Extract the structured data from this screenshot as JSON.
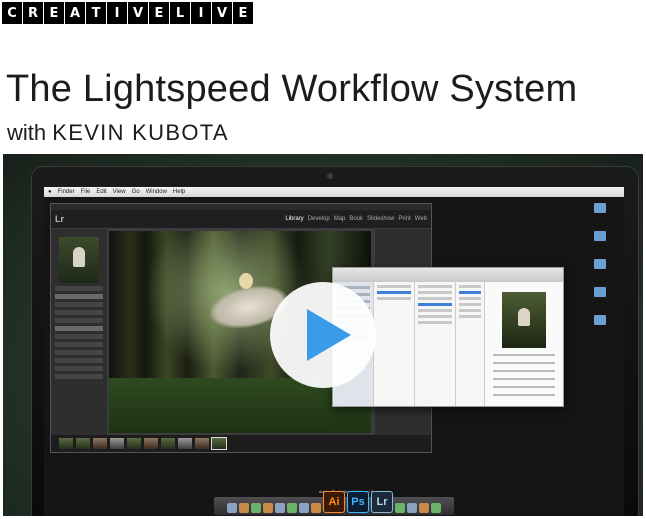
{
  "brand": {
    "letters": [
      "C",
      "R",
      "E",
      "A",
      "T",
      "I",
      "V",
      "E",
      "L",
      "I",
      "V",
      "E"
    ]
  },
  "header": {
    "title": "The Lightspeed Workflow System",
    "with": "with",
    "instructor": "KEVIN KUBOTA"
  },
  "video": {
    "menubar": [
      "Finder",
      "File",
      "Edit",
      "View",
      "Go",
      "Window",
      "Help"
    ],
    "lightroom": {
      "logo": "Lr",
      "modules": [
        "Library",
        "Develop",
        "Map",
        "Book",
        "Slideshow",
        "Print",
        "Web"
      ],
      "active_module": "Library"
    },
    "dock_apps": [
      "Ai",
      "Ps",
      "Lr"
    ],
    "dock_label": "Adobe Photoshop Lightroom 5",
    "play_icon": "play-icon",
    "colors": {
      "play_triangle": "#3a9be8",
      "background_green": "#2c4434"
    }
  }
}
